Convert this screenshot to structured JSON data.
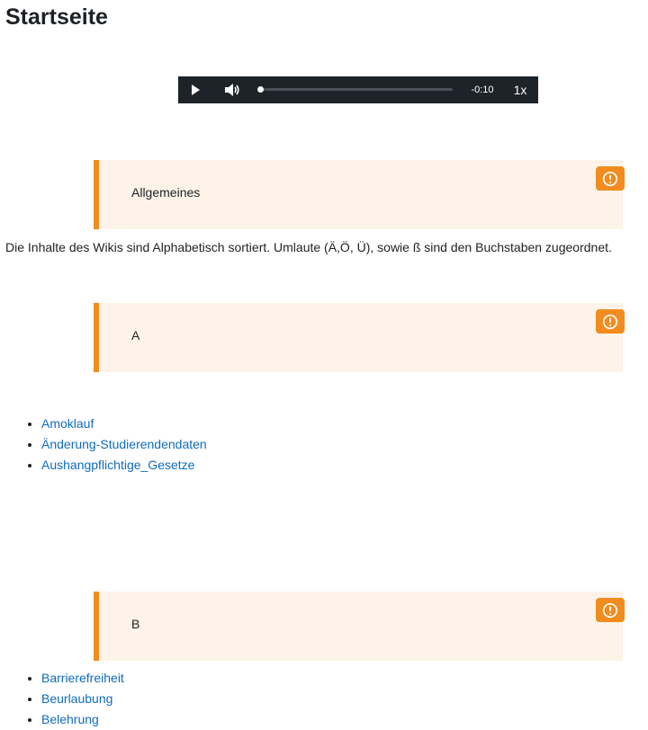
{
  "page": {
    "title": "Startseite"
  },
  "player": {
    "time": "-0:10",
    "rate": "1x",
    "progress": 0.01
  },
  "sections": {
    "allgemeines": {
      "label": "Allgemeines"
    },
    "a": {
      "label": "A"
    },
    "b": {
      "label": "B"
    }
  },
  "intro": "Die Inhalte des Wikis sind Alphabetisch sortiert. Umlaute (Ä,Ö, Ü), sowie ß sind den Buchstaben zugeordnet.",
  "links_a": [
    "Amoklauf",
    "Änderung-Studierendendaten",
    "Aushangpflichtige_Gesetze"
  ],
  "links_b": [
    "Barrierefreiheit",
    "Beurlaubung",
    "Belehrung"
  ],
  "colors": {
    "accent": "#f28c1e",
    "callout_bg": "#fdf3e8",
    "link": "#0f6cbf",
    "player_bg": "#1e2329"
  },
  "icons": {
    "play": "play-icon",
    "volume": "volume-icon",
    "warning": "alert-circle-icon"
  }
}
